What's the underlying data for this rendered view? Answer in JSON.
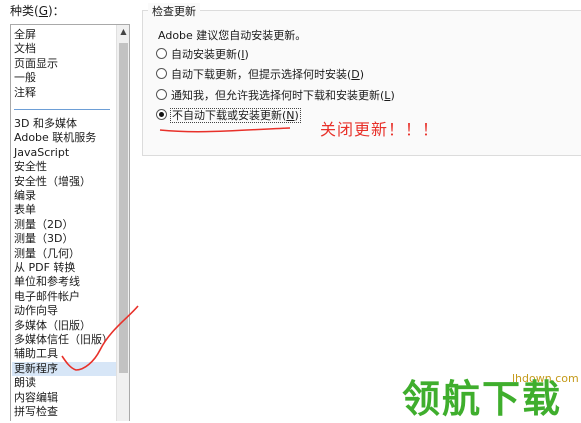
{
  "left_panel": {
    "label_prefix": "种类(",
    "label_mnemonic": "G",
    "label_suffix": ")：",
    "items_top": [
      "全屏",
      "文档",
      "页面显示",
      "一般",
      "注释"
    ],
    "items_bottom": [
      "3D 和多媒体",
      "Adobe 联机服务",
      "JavaScript",
      "安全性",
      "安全性（增强）",
      "编录",
      "表单",
      "测量（2D）",
      "测量（3D）",
      "测量（几何）",
      "从 PDF 转换",
      "单位和参考线",
      "电子邮件帐户",
      "动作向导",
      "多媒体（旧版）",
      "多媒体信任（旧版）",
      "辅助工具",
      "更新程序",
      "朗读",
      "内容编辑",
      "拼写检查"
    ],
    "selected": "更新程序"
  },
  "update_panel": {
    "title": "检查更新",
    "description": "Adobe 建议您自动安装更新。",
    "options": [
      {
        "label": "自动安装更新(",
        "mnemonic": "I",
        "tail": ")",
        "checked": false
      },
      {
        "label": "自动下载更新，但提示选择何时安装(",
        "mnemonic": "D",
        "tail": ")",
        "checked": false
      },
      {
        "label": "通知我，但允许我选择何时下载和安装更新(",
        "mnemonic": "L",
        "tail": ")",
        "checked": false
      },
      {
        "label": "不自动下载或安装更新(",
        "mnemonic": "N",
        "tail": ")",
        "checked": true
      }
    ]
  },
  "annotation": {
    "text": "关闭更新！！！",
    "color": "#e8312a"
  },
  "watermark": {
    "logo": "领航下载",
    "url": "lhdown.com"
  },
  "icons": {
    "scroll_up": "chevron-up-icon"
  }
}
